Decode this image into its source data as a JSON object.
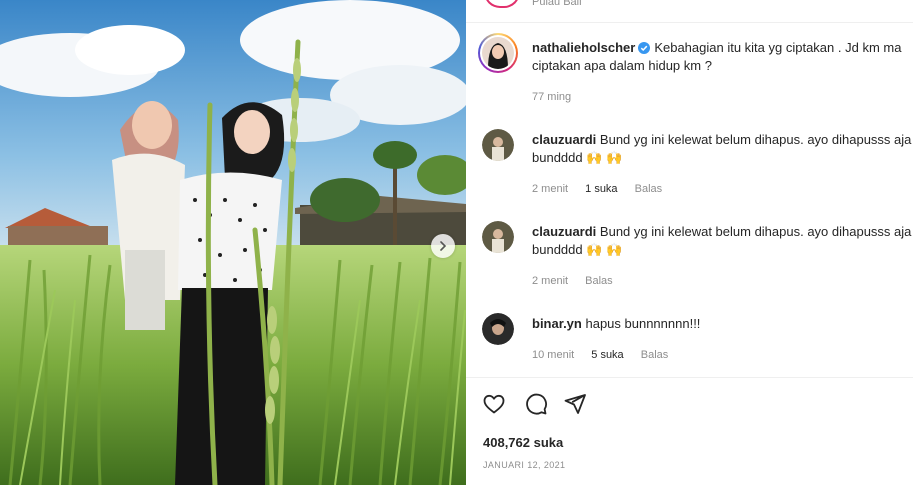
{
  "post": {
    "author": "nathalieholscher",
    "caption": "Kebahagian itu kita yg ciptakan . Jd km ma ciptakan apa dalam hidup km ?",
    "caption_age": "77 ming",
    "top_location": "Pulau Bali"
  },
  "comments": [
    {
      "user": "clauzuardi",
      "text": "Bund yg ini kelewat belum dihapus. ayo dihapusss aja bundddd 🙌 🙌",
      "age": "2 menit",
      "likes": "1 suka",
      "reply": "Balas"
    },
    {
      "user": "clauzuardi",
      "text": "Bund yg ini kelewat belum dihapus. ayo dihapusss aja bundddd 🙌 🙌",
      "age": "2 menit",
      "likes": "",
      "reply": "Balas"
    },
    {
      "user": "binar.yn",
      "text": "hapus bunnnnnnn!!!",
      "age": "10 menit",
      "likes": "5 suka",
      "reply": "Balas"
    }
  ],
  "stats": {
    "likes": "408,762 suka",
    "date": "JANUARI 12, 2021"
  },
  "icons": {
    "like": "heart-icon",
    "comment": "comment-icon",
    "share": "send-icon",
    "next": "chevron-right-icon",
    "verified": "verified-badge-icon"
  },
  "colors": {
    "verified": "#3897f0",
    "muted": "#8e8e8e",
    "text": "#262626"
  }
}
